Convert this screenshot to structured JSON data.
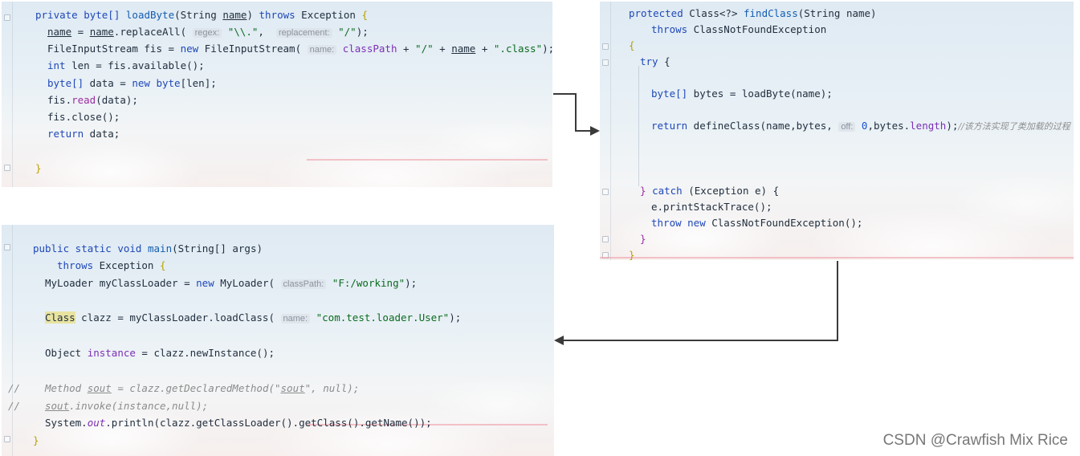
{
  "panel_load_byte": {
    "lines": {
      "l1_kw": "private byte[]",
      "l1_fn": "loadByte",
      "l1_rest_a": "(String ",
      "l1_name": "name",
      "l1_rest_b": ") ",
      "l1_throws": "throws",
      "l1_exc": " Exception ",
      "l1_brace": "{",
      "l2_name": "name",
      "l2_eq": " = ",
      "l2_name2": "name",
      "l2_call": ".replaceAll(",
      "l2_hint1": "regex:",
      "l2_str1": "\"\\\\.\"",
      "l2_comma": ", ",
      "l2_hint2": "replacement:",
      "l2_str2": "\"/\"",
      "l2_end": ");",
      "l3_a": "FileInputStream fis = ",
      "l3_new": "new",
      "l3_b": " FileInputStream(",
      "l3_hint": "name:",
      "l3_field": "classPath",
      "l3_c": " + ",
      "l3_str1": "\"/\"",
      "l3_d": " + ",
      "l3_name": "name",
      "l3_e": " + ",
      "l3_str2": "\".class\"",
      "l3_end": ");",
      "l4_kw": "int",
      "l4_rest": " len = fis.available();",
      "l5_kw": "byte[]",
      "l5_a": " data = ",
      "l5_new": "new",
      "l5_b": " ",
      "l5_byte": "byte",
      "l5_c": "[len];",
      "l6_a": "fis.",
      "l6_fn": "read",
      "l6_b": "(data);",
      "l7": "fis.close();",
      "l8_kw": "return",
      "l8_rest": " data;",
      "l9_brace": "}"
    }
  },
  "panel_find_class": {
    "lines": {
      "l1_kw": "protected",
      "l1_a": " Class<?> ",
      "l1_fn": "findClass",
      "l1_b": "(String name)",
      "l2_kw": "throws",
      "l2_rest": " ClassNotFoundException",
      "l3_brace": "{",
      "l4_kw": "try",
      "l4_rest": " {",
      "l5_kw": "byte[]",
      "l5_rest": " bytes = loadByte(name);",
      "l6_kw": "return",
      "l6_a": " defineClass(name,bytes, ",
      "l6_hint": "off:",
      "l6_num": " 0",
      "l6_b": ",bytes.",
      "l6_field": "length",
      "l6_c": ");",
      "l6_cmt": "//该方法实现了类加载的过程",
      "l7_a": "} ",
      "l7_kw": "catch",
      "l7_rest": " (Exception e) {",
      "l8": "e.printStackTrace();",
      "l9_kw": "throw new",
      "l9_rest": " ClassNotFoundException();",
      "l10": "}",
      "l11_brace": "}"
    }
  },
  "panel_main": {
    "lines": {
      "l1_kw": "public static void",
      "l1_fn": " main",
      "l1_rest": "(String[] args)",
      "l2_kw": "throws",
      "l2_rest": " Exception ",
      "l2_brace": "{",
      "l3_a": "MyLoader myClassLoader = ",
      "l3_new": "new",
      "l3_b": " MyLoader(",
      "l3_hint": "classPath:",
      "l3_str": " \"F:/working\"",
      "l3_end": ");",
      "l4_class": "Class",
      "l4_a": " clazz = myClassLoader.loadClass(",
      "l4_hint": "name:",
      "l4_str": " \"com.test.loader.User\"",
      "l4_end": ");",
      "l5_a": "Object ",
      "l5_field": "instance",
      "l5_b": " = clazz.newInstance();",
      "l6_slash": "//",
      "l6_cmt_a": "Method ",
      "l6_sout": "sout",
      "l6_cmt_b": " = clazz.getDeclaredMethod(\"",
      "l6_sout2": "sout",
      "l6_cmt_c": "\", null);",
      "l7_slash": "//",
      "l7_sout": "sout",
      "l7_cmt": ".invoke(instance,null);",
      "l8_a": "System.",
      "l8_out": "out",
      "l8_b": ".println(clazz.getClassLoader().getClass().getName());",
      "l9_brace": "}"
    }
  },
  "watermark": "CSDN @Crawfish Mix Rice",
  "colors": {
    "keyword": "#1f48b8",
    "string": "#0b6b1e",
    "field": "#7b2fb5",
    "comment": "#8c8c8c"
  }
}
